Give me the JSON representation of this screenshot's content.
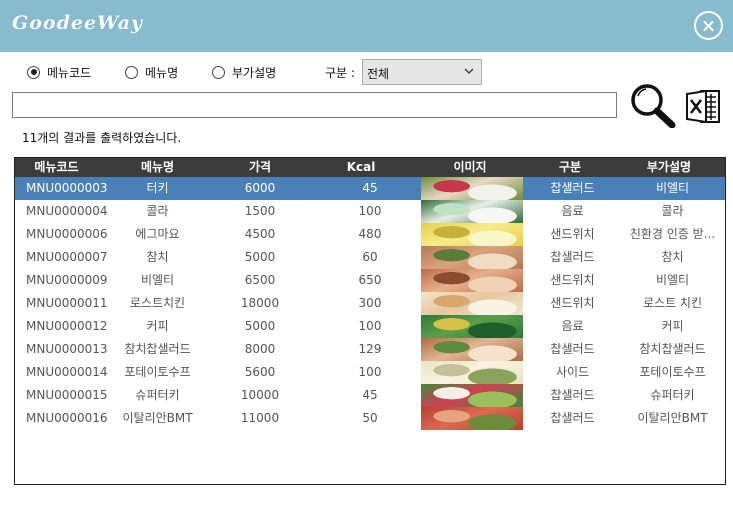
{
  "app": {
    "logo_text": "GoodeeWay"
  },
  "filters": {
    "radios": [
      {
        "label": "메뉴코드",
        "checked": true
      },
      {
        "label": "메뉴명",
        "checked": false
      },
      {
        "label": "부가설명",
        "checked": false
      }
    ],
    "category_label": "구분 :",
    "category_value": "전체"
  },
  "search": {
    "value": ""
  },
  "result_text": "11개의 결과를 출력하였습니다.",
  "grid": {
    "columns": [
      "메뉴코드",
      "메뉴명",
      "가격",
      "Kcal",
      "이미지",
      "구분",
      "부가설명"
    ],
    "rows": [
      {
        "code": "MNU0000003",
        "name": "터키",
        "price": "6000",
        "kcal": "45",
        "image": "sandwich-turkey",
        "category": "찹샐러드",
        "desc": "비엘티",
        "selected": true
      },
      {
        "code": "MNU0000004",
        "name": "콜라",
        "price": "1500",
        "kcal": "100",
        "image": "drink-cola",
        "category": "음료",
        "desc": "콜라"
      },
      {
        "code": "MNU0000006",
        "name": "에그마요",
        "price": "4500",
        "kcal": "480",
        "image": "sandwich-egg",
        "category": "샌드위치",
        "desc": "친환경 인증 받..."
      },
      {
        "code": "MNU0000007",
        "name": "참치",
        "price": "5000",
        "kcal": "60",
        "image": "sandwich-tuna",
        "category": "찹샐러드",
        "desc": "참치"
      },
      {
        "code": "MNU0000009",
        "name": "비엘티",
        "price": "6500",
        "kcal": "650",
        "image": "sandwich-blt",
        "category": "샌드위치",
        "desc": "비엘티"
      },
      {
        "code": "MNU0000011",
        "name": "로스트치킨",
        "price": "18000",
        "kcal": "300",
        "image": "sandwich-chicken",
        "category": "샌드위치",
        "desc": "로스트 치킨"
      },
      {
        "code": "MNU0000012",
        "name": "커피",
        "price": "5000",
        "kcal": "100",
        "image": "drink-coffee",
        "category": "음료",
        "desc": "커피"
      },
      {
        "code": "MNU0000013",
        "name": "참치찹샐러드",
        "price": "8000",
        "kcal": "129",
        "image": "salad-tuna",
        "category": "찹샐러드",
        "desc": "참치찹샐러드"
      },
      {
        "code": "MNU0000014",
        "name": "포테이토수프",
        "price": "5600",
        "kcal": "100",
        "image": "soup-potato",
        "category": "사이드",
        "desc": "포테이토수프"
      },
      {
        "code": "MNU0000015",
        "name": "슈퍼터키",
        "price": "10000",
        "kcal": "45",
        "image": "sandwich-super-turkey",
        "category": "찹샐러드",
        "desc": "슈퍼터키"
      },
      {
        "code": "MNU0000016",
        "name": "이탈리안BMT",
        "price": "11000",
        "kcal": "50",
        "image": "sandwich-bmt",
        "category": "찹샐러드",
        "desc": "이탈리안BMT"
      }
    ]
  },
  "colors": {
    "titlebar": "#87bccf",
    "header": "#3c3c3c",
    "selected_row": "#4a80b8"
  }
}
